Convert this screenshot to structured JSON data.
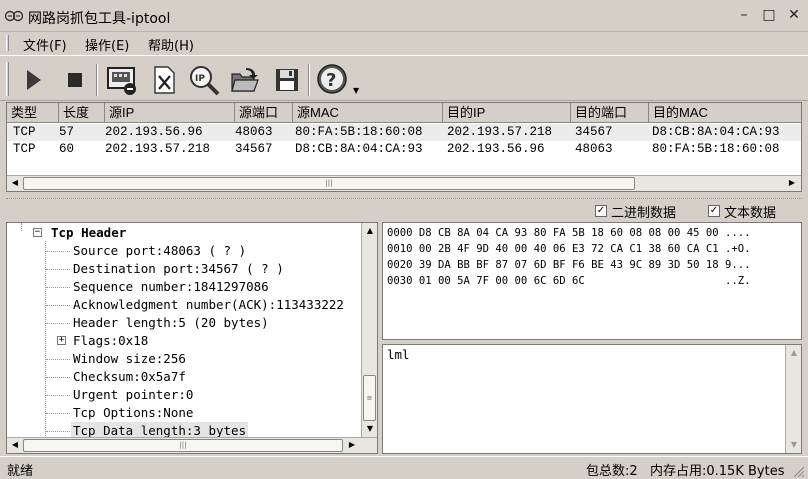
{
  "window": {
    "title": "网路岗抓包工具-iptool",
    "app_icon": "network-sniffer-icon",
    "controls": {
      "minimize": "–",
      "maximize": "□",
      "close": "✕"
    }
  },
  "menubar": {
    "items": [
      {
        "label": "文件(F)"
      },
      {
        "label": "操作(E)"
      },
      {
        "label": "帮助(H)"
      }
    ]
  },
  "toolbar": {
    "buttons": [
      {
        "icon": "play-icon",
        "name": "start-capture-button"
      },
      {
        "icon": "stop-icon",
        "name": "stop-capture-button"
      },
      {
        "icon": "adapter-settings-icon",
        "name": "adapter-button"
      },
      {
        "icon": "clear-icon",
        "name": "clear-button"
      },
      {
        "icon": "ip-search-icon",
        "name": "ip-filter-button"
      },
      {
        "icon": "open-folder-icon",
        "name": "open-button"
      },
      {
        "icon": "save-disk-icon",
        "name": "save-button"
      },
      {
        "icon": "help-icon",
        "name": "help-button"
      }
    ]
  },
  "packets": {
    "columns": [
      "类型",
      "长度",
      "源IP",
      "源端口",
      "源MAC",
      "目的IP",
      "目的端口",
      "目的MAC"
    ],
    "rows": [
      [
        "TCP",
        "57",
        "202.193.56.96",
        "48063",
        "80:FA:5B:18:60:08",
        "202.193.57.218",
        "34567",
        "D8:CB:8A:04:CA:93"
      ],
      [
        "TCP",
        "60",
        "202.193.57.218",
        "34567",
        "D8:CB:8A:04:CA:93",
        "202.193.56.96",
        "48063",
        "80:FA:5B:18:60:08"
      ]
    ]
  },
  "options": {
    "binary_label": "二进制数据",
    "binary_checked": true,
    "text_label": "文本数据",
    "text_checked": true
  },
  "tree": {
    "header": "Tcp Header",
    "items": [
      {
        "label": "Source port:48063 ( ? )"
      },
      {
        "label": "Destination port:34567 ( ? )"
      },
      {
        "label": "Sequence number:1841297086"
      },
      {
        "label": "Acknowledgment number(ACK):113433222"
      },
      {
        "label": "Header length:5 (20 bytes)"
      },
      {
        "label": "Flags:0x18",
        "expandable": true
      },
      {
        "label": "Window size:256"
      },
      {
        "label": "Checksum:0x5a7f"
      },
      {
        "label": "Urgent pointer:0"
      },
      {
        "label": "Tcp Options:None"
      },
      {
        "label": "Tcp Data length:3 bytes"
      }
    ]
  },
  "hex_dump": [
    "0000 D8 CB 8A 04 CA 93 80 FA 5B 18 60 08 08 00 45 00 ....",
    "0010 00 2B 4F 9D 40 00 40 06 E3 72 CA C1 38 60 CA C1 .+O.",
    "0020 39 DA BB BF 87 07 6D BF F6 BE 43 9C 89 3D 50 18 9...",
    "0030 01 00 5A 7F 00 00 6C 6D 6C                      ..Z."
  ],
  "text_data": "lml",
  "status": {
    "ready": "就绪",
    "packet_count": "包总数:2",
    "memory": "内存占用:0.15K Bytes"
  }
}
